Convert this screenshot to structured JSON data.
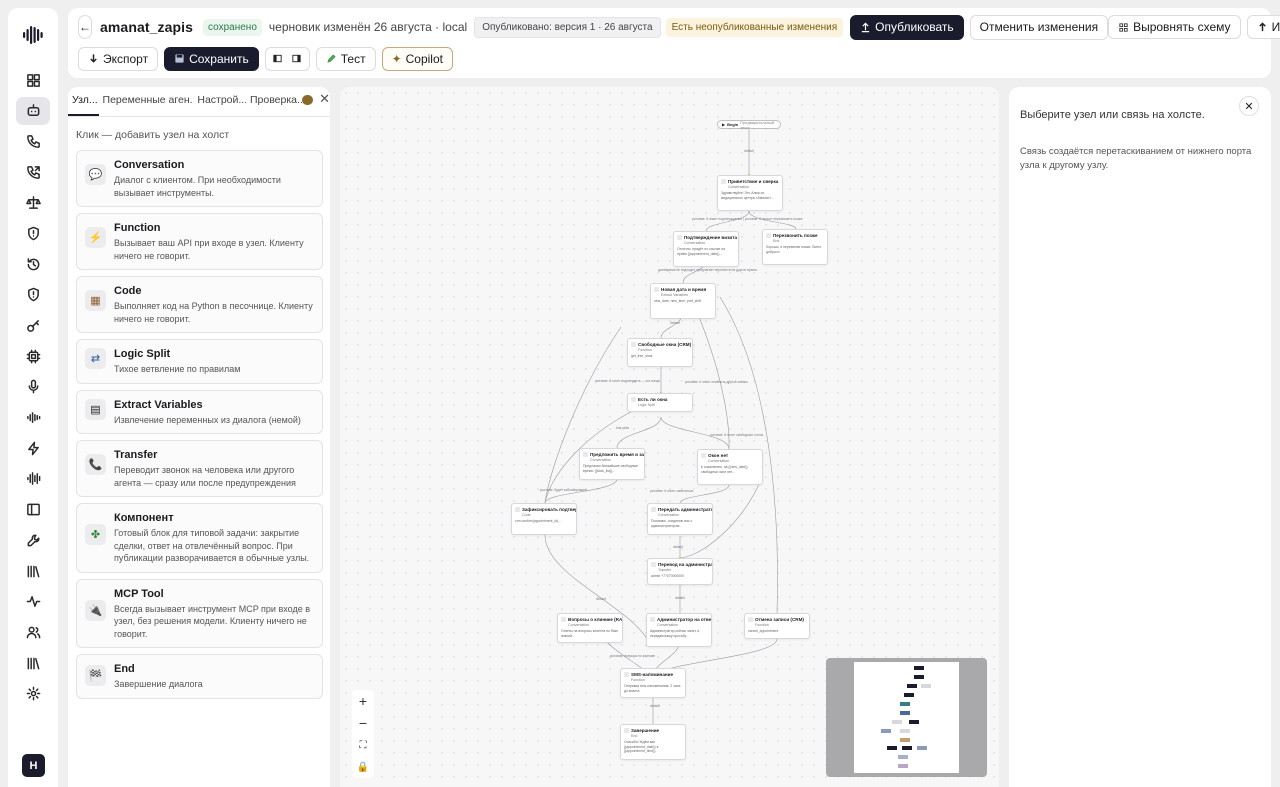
{
  "header": {
    "back_label": "←",
    "title": "amanat_zapis",
    "saved_badge": "сохранено",
    "draft_text": "черновик изменён 26 августа · local",
    "published_chip": "Опубликовано: версия 1 · 26 августа",
    "unpublished_chip": "Есть неопубликованные изменения",
    "publish_label": "Опубликовать",
    "revert_label": "Отменить изменения",
    "align_label": "Выровнять схему",
    "import_label": "Импорт",
    "export_label": "Экспорт",
    "save_label": "Сохранить",
    "test_label": "Тест",
    "copilot_label": "Copilot"
  },
  "left_panel": {
    "tabs": [
      {
        "label": "Узл..."
      },
      {
        "label": "Переменные аген..."
      },
      {
        "label": "Настрой..."
      },
      {
        "label": "Проверка..."
      }
    ],
    "hint": "Клик — добавить узел на холст",
    "cards": [
      {
        "icon": "chat-icon",
        "glyph": "💬",
        "title": "Conversation",
        "desc": "Диалог с клиентом. При необходимости вызывает инструменты."
      },
      {
        "icon": "function-icon",
        "glyph": "⚡",
        "title": "Function",
        "desc": "Вызывает ваш API при входе в узел. Клиенту ничего не говорит."
      },
      {
        "icon": "code-icon",
        "glyph": "▦",
        "title": "Code",
        "desc": "Выполняет код на Python в песочнице. Клиенту ничего не говорит."
      },
      {
        "icon": "logic-split-icon",
        "glyph": "⇄",
        "title": "Logic Split",
        "desc": "Тихое ветвление по правилам"
      },
      {
        "icon": "extract-icon",
        "glyph": "▤",
        "title": "Extract Variables",
        "desc": "Извлечение переменных из диалога (немой)"
      },
      {
        "icon": "transfer-icon",
        "glyph": "📞",
        "title": "Transfer",
        "desc": "Переводит звонок на человека или другого агента — сразу или после предупреждения"
      },
      {
        "icon": "component-icon",
        "glyph": "✤",
        "title": "Компонент",
        "desc": "Готовый блок для типовой задачи: закрытие сделки, ответ на отвлечённый вопрос. При публикации разворачивается в обычные узлы."
      },
      {
        "icon": "mcp-tool-icon",
        "glyph": "🔌",
        "title": "MCP Tool",
        "desc": "Всегда вызывает инструмент MCP при входе в узел, без решения модели. Клиенту ничего не говорит."
      },
      {
        "icon": "end-icon",
        "glyph": "🏁",
        "title": "End",
        "desc": "Завершение диалога"
      }
    ]
  },
  "canvas": {
    "begin_label": "Begin",
    "begin_sub": "Предварительный текст",
    "nodes": [
      {
        "title": "Приветствие и сверка",
        "sub": "Conversation",
        "desc": "Здравствуйте! Это Алма из медицинского центра «Аманат»..."
      },
      {
        "title": "Подтверждение визита",
        "sub": "Conversation",
        "desc": "Отлично, придёт по ссылке на приём {{appointment_date}}..."
      },
      {
        "title": "Перезвонить позже",
        "sub": "End",
        "desc": "Хорошо, я перезвоню позже. Всего доброго!"
      },
      {
        "title": "Новая дата и время",
        "sub": "Extract Variables",
        "desc": "new_date, new_time, pref_shift"
      },
      {
        "title": "Свободные окна (CRM)",
        "sub": "Function",
        "desc": "get_free_slots"
      },
      {
        "title": "Есть ли окна",
        "sub": "Logic Split",
        "desc": ""
      },
      {
        "title": "Предложить время и за...",
        "sub": "Conversation",
        "desc": "Предлагаю ближайшие свободные время: {{slots_list}}..."
      },
      {
        "title": "Окон нет",
        "sub": "Conversation",
        "desc": "К сожалению, на {{new_date}} свободных окон нет..."
      },
      {
        "title": "Зафиксировать подтвер...",
        "sub": "Code",
        "desc": "crm.confirm(appointment_id)..."
      },
      {
        "title": "Передать администрато...",
        "sub": "Conversation",
        "desc": "Понимаю, соединяю вас с администратором..."
      },
      {
        "title": "Перевод на администрат...",
        "sub": "Transfer",
        "desc": "admin +77070000000"
      },
      {
        "title": "Вопросы о клинике (RAG)",
        "sub": "Conversation",
        "desc": "Ответы на вопросы клиента по базе знаний..."
      },
      {
        "title": "Администратор на ответ...",
        "sub": "Conversation",
        "desc": "Администратор сейчас занят, я передам вашу просьбу..."
      },
      {
        "title": "Отмена записи (CRM)",
        "sub": "Function",
        "desc": "cancel_appointment"
      },
      {
        "title": "SMS-напоминание",
        "sub": "Function",
        "desc": "Отправка sms-напоминания: 2 часа до визита"
      },
      {
        "title": "Завершение",
        "sub": "End",
        "desc": "Спасибо! Ждём вас {{appointment_date}} в {{appointment_time}}."
      }
    ]
  },
  "right_panel": {
    "close_label": "✕",
    "title": "Выберите узел или связь на холсте.",
    "text": "Связь создаётся перетаскиванием от нижнего порта узла к другому узлу."
  },
  "user": {
    "avatar_letter": "Н"
  }
}
